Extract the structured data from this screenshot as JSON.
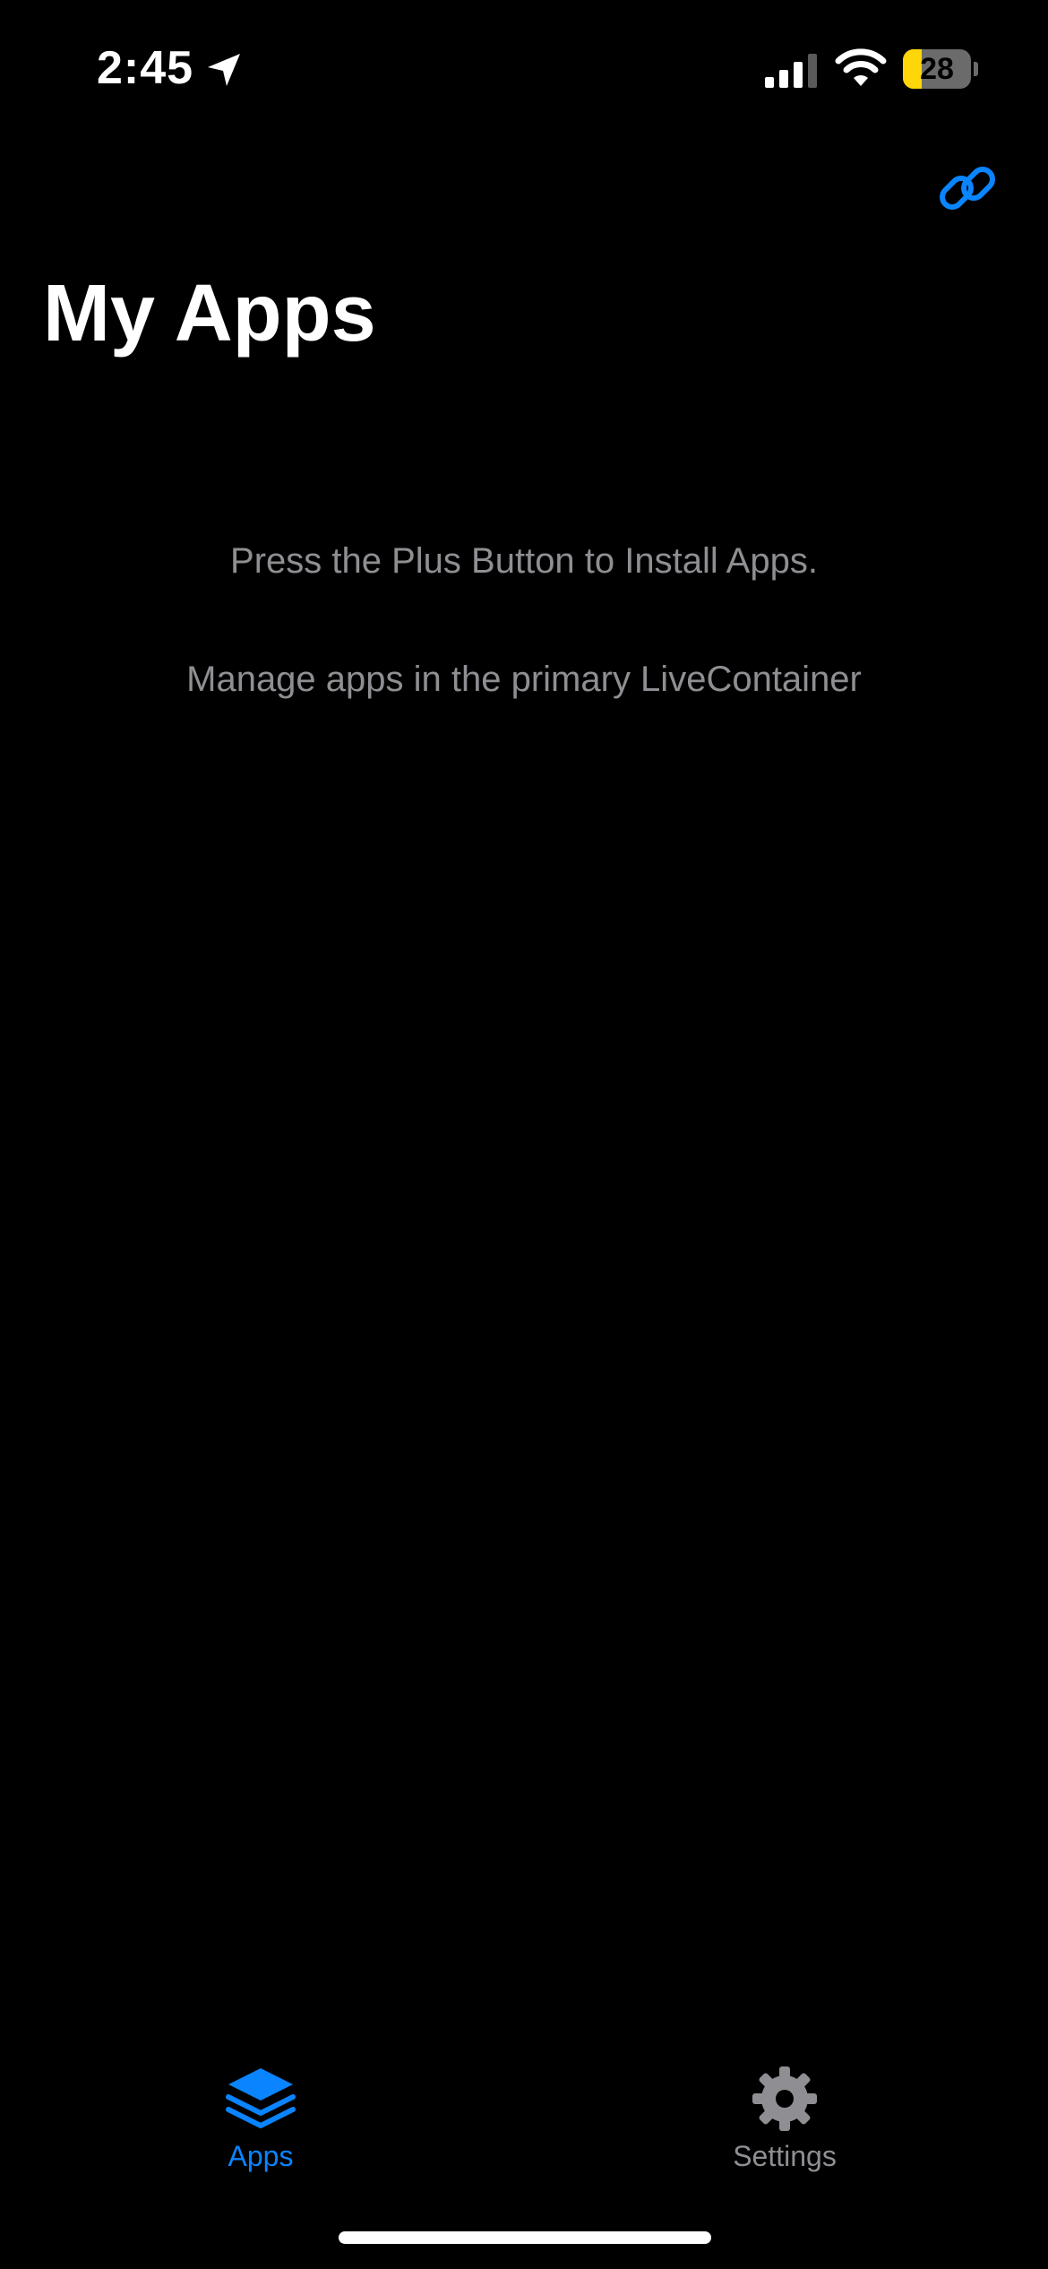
{
  "status_bar": {
    "time": "2:45",
    "battery_level": "28",
    "battery_fraction": 0.28,
    "battery_charging": true,
    "signal_bars": 3,
    "location_active": true,
    "icons": [
      "location-arrow-icon",
      "cellular-signal-icon",
      "wifi-icon",
      "battery-charging-icon"
    ]
  },
  "nav": {
    "title": "My Apps",
    "right_button_icon": "link-icon"
  },
  "empty_state": {
    "install_hint": "Press the Plus Button to Install Apps.",
    "manage_hint": "Manage apps in the primary LiveContainer"
  },
  "tabs": [
    {
      "label": "Apps",
      "icon": "stack-icon",
      "selected": true
    },
    {
      "label": "Settings",
      "icon": "gear-icon",
      "selected": false
    }
  ],
  "colors": {
    "background": "#000000",
    "accent": "#0a84ff",
    "secondary_text": "#8e8e93",
    "battery_fill": "#ffd60a"
  }
}
